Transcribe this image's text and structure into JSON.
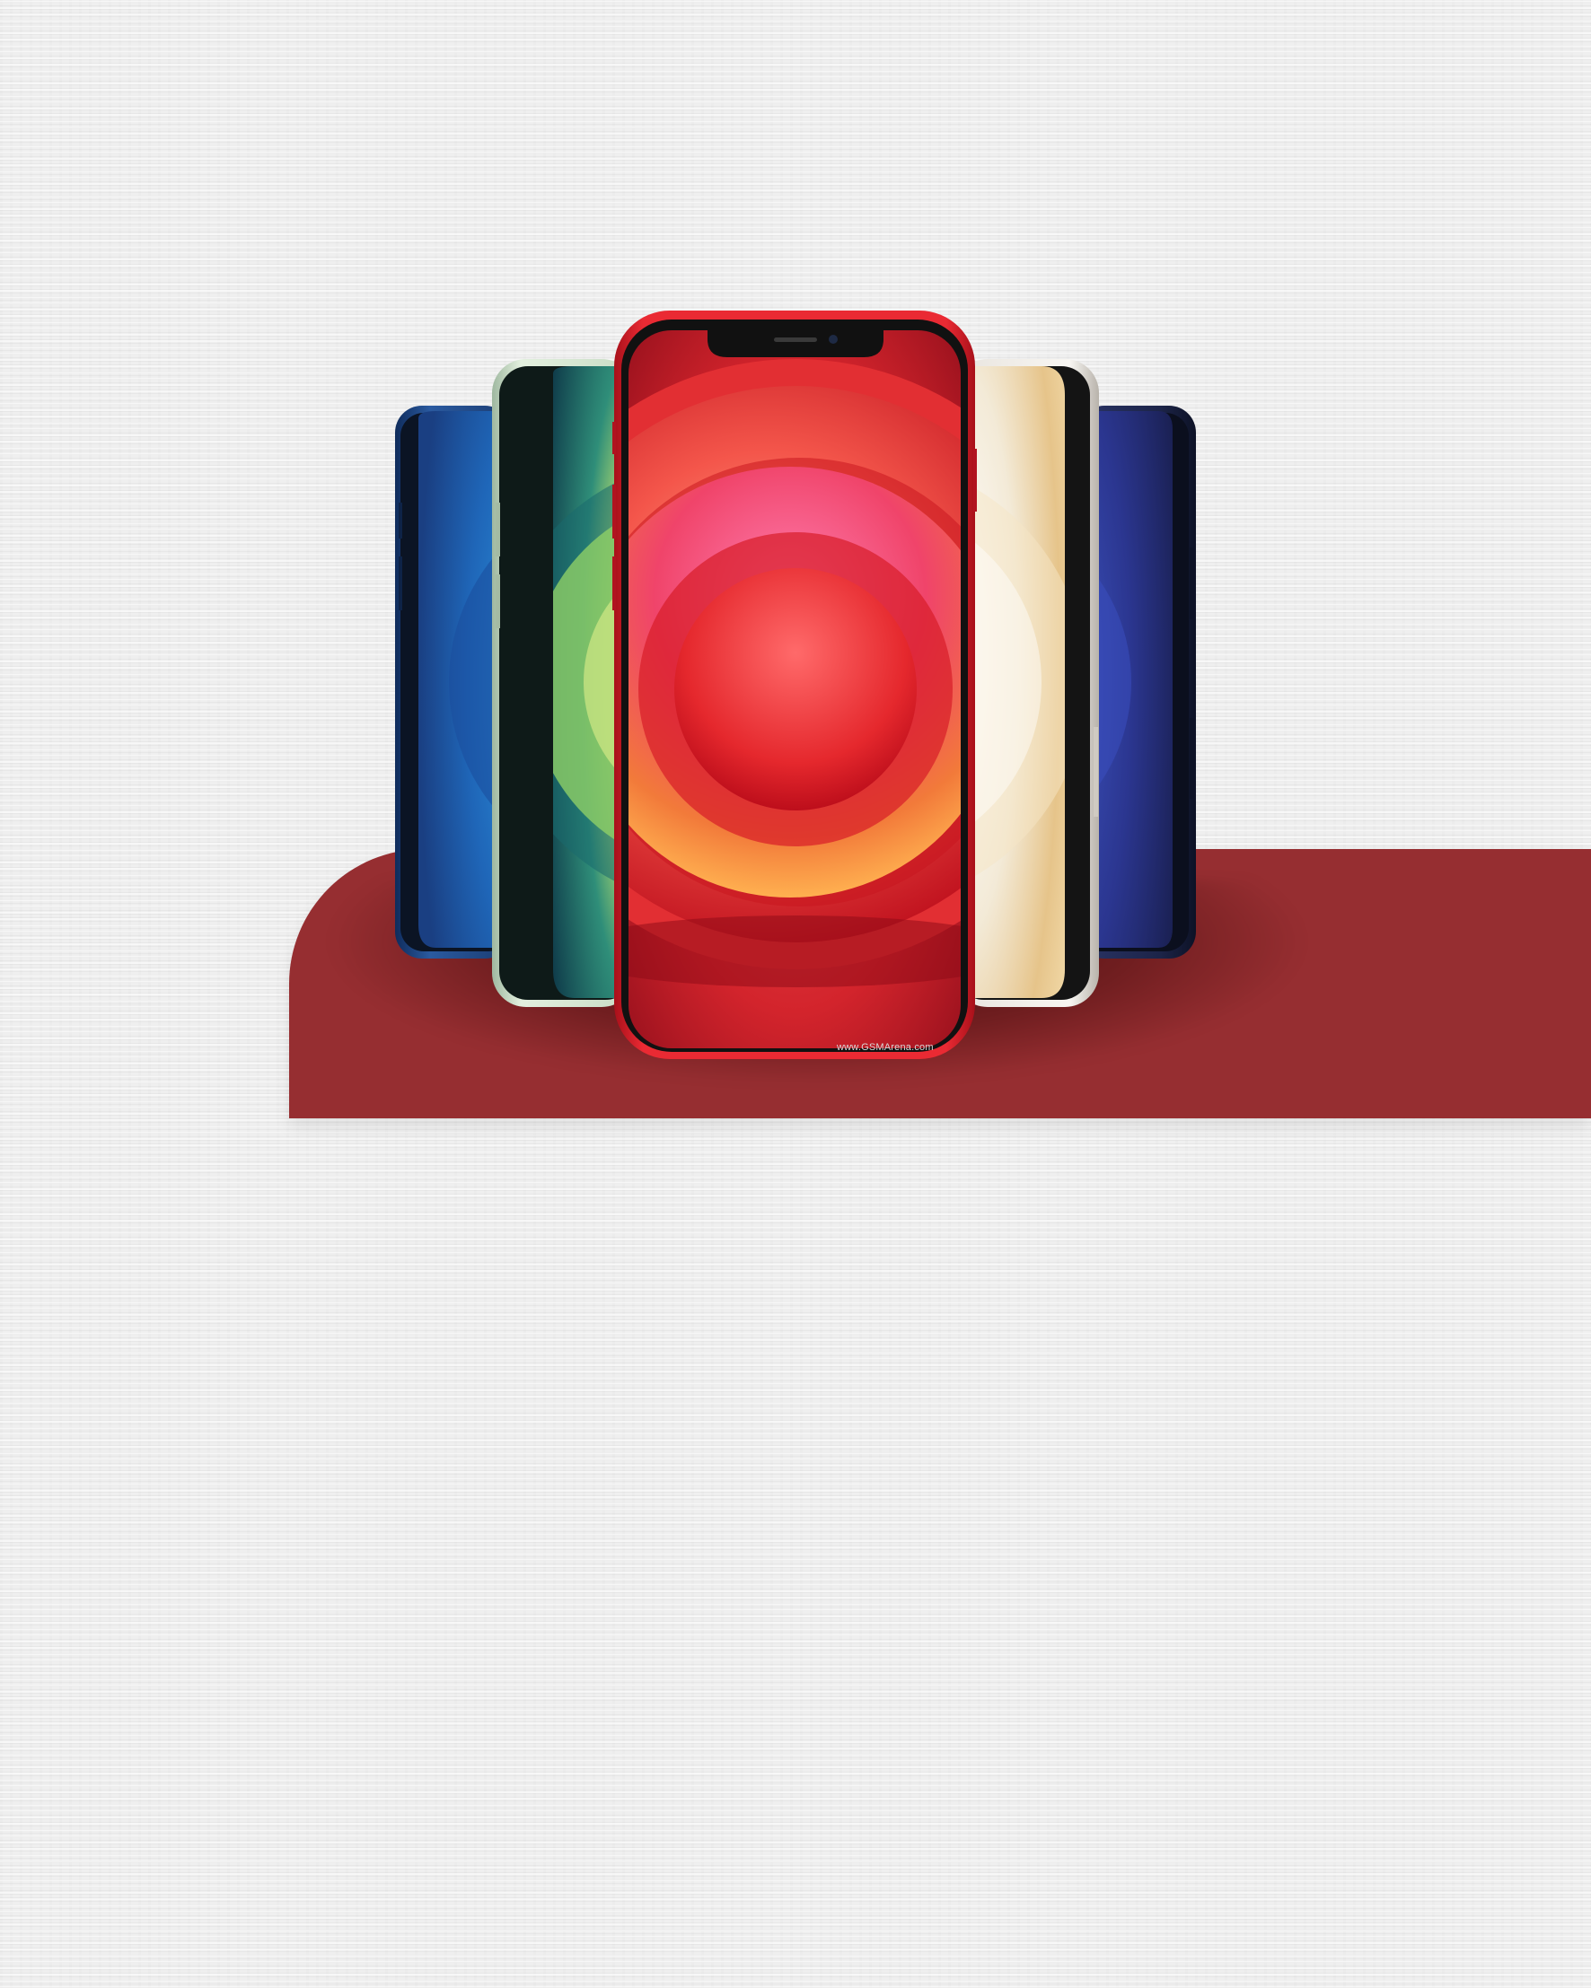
{
  "watermark": "www.GSMArena.com",
  "colors": {
    "background": "#efefef",
    "band": "#962e31",
    "phone_red": "#d51b23",
    "phone_blue": "#1f4b8f",
    "phone_green": "#cfe3c9",
    "phone_white": "#f1eeea",
    "phone_navy": "#1a2449"
  },
  "products": [
    {
      "name": "blue-phone"
    },
    {
      "name": "green-phone"
    },
    {
      "name": "red-phone"
    },
    {
      "name": "white-phone"
    },
    {
      "name": "navy-phone"
    }
  ]
}
